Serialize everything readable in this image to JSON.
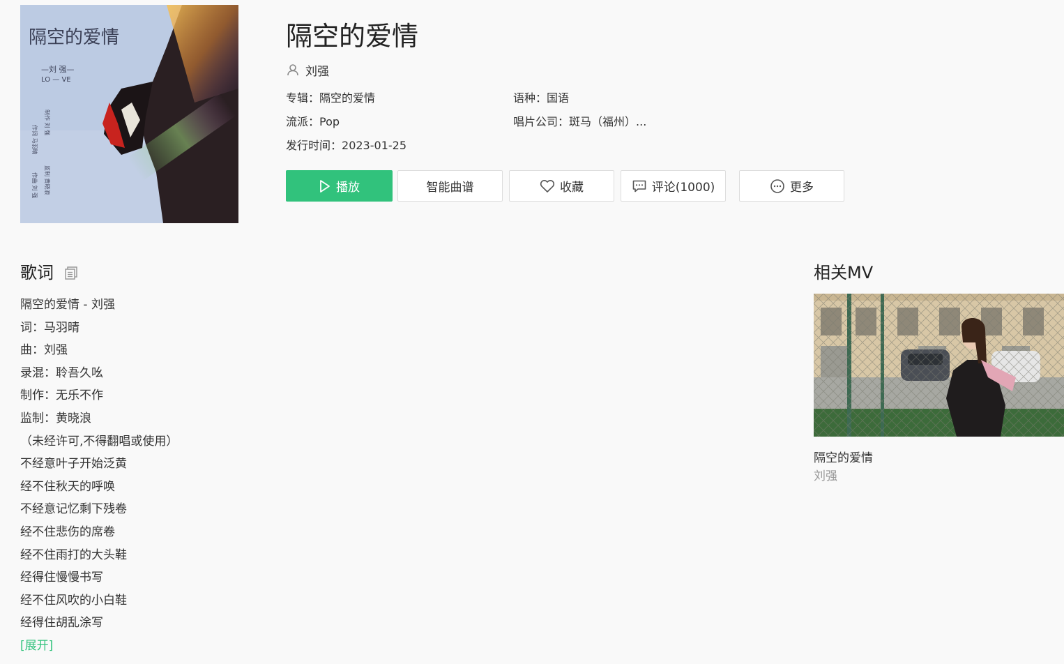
{
  "song": {
    "title": "隔空的爱情",
    "artist": "刘强",
    "album_label": "专辑：",
    "album": "隔空的爱情",
    "language_label": "语种：",
    "language": "国语",
    "genre_label": "流派：",
    "genre": "Pop",
    "company_label": "唱片公司：",
    "company": "斑马（福州）...",
    "release_label": "发行时间：",
    "release_date": "2023-01-25"
  },
  "cover": {
    "title_text": "隔空的爱情",
    "tag_text": "—刘 强—",
    "tag_sub": "LO — VE",
    "credits": [
      "作词 马羽晴",
      "作曲 刘 强",
      "制作 刘 强",
      "监制 黄晓浪"
    ]
  },
  "actions": {
    "play": "播放",
    "score": "智能曲谱",
    "favorite": "收藏",
    "comment": "评论(1000)",
    "more": "更多"
  },
  "lyrics": {
    "title": "歌词",
    "lines": [
      "隔空的爱情 - 刘强",
      "词：马羽晴",
      "曲：刘强",
      "录混：聆吾久吆",
      "制作：无乐不作",
      "监制：黄晓浪",
      "（未经许可,不得翻唱或使用）",
      "不经意叶子开始泛黄",
      "经不住秋天的呼唤",
      "不经意记忆剩下残卷",
      "经不住悲伤的席卷",
      "经不住雨打的大头鞋",
      "经得住慢慢书写",
      "经不住风吹的小白鞋",
      "经得住胡乱涂写"
    ],
    "expand": "[展开]"
  },
  "mv": {
    "section_title": "相关MV",
    "title": "隔空的爱情",
    "artist": "刘强"
  },
  "colors": {
    "accent": "#31c27c",
    "background": "#f9f9f9",
    "text": "#333333",
    "muted": "#999999"
  }
}
